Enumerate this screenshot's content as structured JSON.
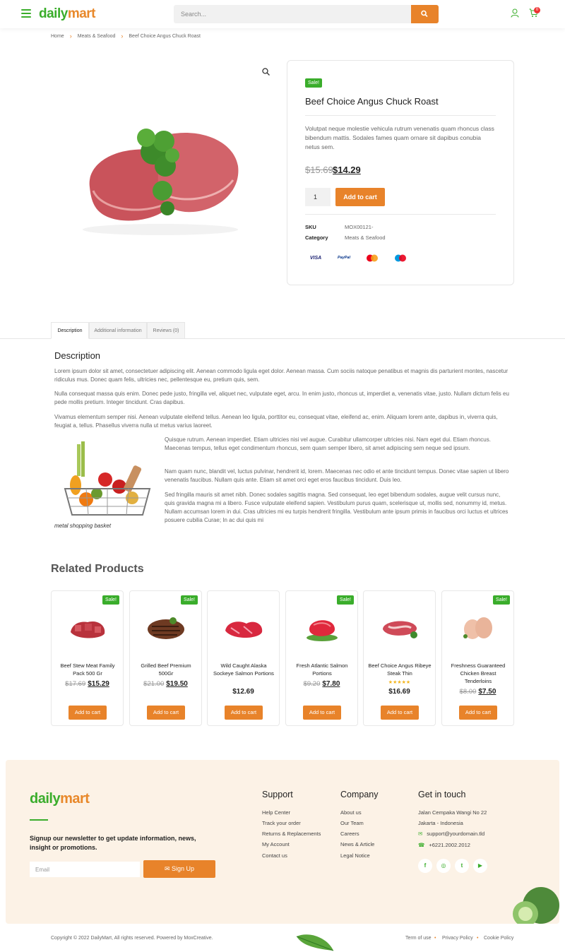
{
  "header": {
    "logo_part1": "daily",
    "logo_part2": "mart",
    "search_placeholder": "Search...",
    "cart_count": "0"
  },
  "breadcrumb": [
    "Home",
    "Meats & Seafood",
    "Beef Choice Angus Chuck Roast"
  ],
  "product": {
    "sale_label": "Sale!",
    "title": "Beef Choice Angus Chuck Roast",
    "description": "Volutpat neque molestie vehicula rutrum venenatis quam rhoncus class bibendum mattis. Sodales fames quam ornare sit dapibus conubia netus sem.",
    "old_price": "$15.69",
    "new_price": "$14.29",
    "quantity": "1",
    "add_to_cart": "Add to cart",
    "sku_label": "SKU",
    "sku_value": "MOX00121-",
    "category_label": "Category",
    "category_value": "Meats & Seafood",
    "payments": [
      "VISA",
      "PayPal",
      "Mastercard",
      "Maestro"
    ]
  },
  "tabs": [
    "Description",
    "Additional information",
    "Reviews (0)"
  ],
  "description": {
    "heading": "Description",
    "paragraphs": [
      "Lorem ipsum dolor sit amet, consectetuer adipiscing elit. Aenean commodo ligula eget dolor. Aenean massa. Cum sociis natoque penatibus et magnis dis parturient montes, nascetur ridiculus mus. Donec quam felis, ultricies nec, pellentesque eu, pretium quis, sem.",
      "Nulla consequat massa quis enim. Donec pede justo, fringilla vel, aliquet nec, vulputate eget, arcu. In enim justo, rhoncus ut, imperdiet a, venenatis vitae, justo. Nullam dictum felis eu pede mollis pretium. Integer tincidunt. Cras dapibus.",
      "Vivamus elementum semper nisi. Aenean vulputate eleifend tellus. Aenean leo ligula, porttitor eu, consequat vitae, eleifend ac, enim. Aliquam lorem ante, dapibus in, viverra quis, feugiat a, tellus. Phasellus viverra nulla ut metus varius laoreet.",
      "Quisque rutrum. Aenean imperdiet. Etiam ultricies nisi vel augue. Curabitur ullamcorper ultricies nisi. Nam eget dui. Etiam rhoncus. Maecenas tempus, tellus eget condimentum rhoncus, sem quam semper libero, sit amet adipiscing sem neque sed ipsum.",
      "Nam quam nunc, blandit vel, luctus pulvinar, hendrerit id, lorem. Maecenas nec odio et ante tincidunt tempus. Donec vitae sapien ut libero venenatis faucibus. Nullam quis ante. Etiam sit amet orci eget eros faucibus tincidunt. Duis leo.",
      "Sed fringilla mauris sit amet nibh. Donec sodales sagittis magna. Sed consequat, leo eget bibendum sodales, augue velit cursus nunc, quis gravida magna mi a libero. Fusce vulputate eleifend sapien. Vestibulum purus quam, scelerisque ut, mollis sed, nonummy id, metus. Nullam accumsan lorem in dui. Cras ultricies mi eu turpis hendrerit fringilla. Vestibulum ante ipsum primis in faucibus orci luctus et ultrices posuere cubilia Curae; In ac dui quis mi"
    ],
    "caption": "metal shopping basket"
  },
  "related": {
    "heading": "Related Products",
    "sale_label": "Sale!",
    "button": "Add to cart",
    "items": [
      {
        "name": "Beef Stew Meat Family Pack 500 Gr",
        "old": "$17.69",
        "price": "$15.29",
        "sale": true
      },
      {
        "name": "Grilled Beef Premium 500Gr",
        "old": "$21.00",
        "price": "$19.50",
        "sale": true
      },
      {
        "name": "Wild Caught Alaska Sockeye Salmon Portions",
        "old": "",
        "price": "$12.69",
        "sale": false
      },
      {
        "name": "Fresh Atlantic Salmon Portions",
        "old": "$9.20",
        "price": "$7.80",
        "sale": true
      },
      {
        "name": "Beef Choice Angus Ribeye Steak Thin",
        "old": "",
        "price": "$16.69",
        "sale": false,
        "rating": 5
      },
      {
        "name": "Freshness Guaranteed Chicken Breast Tenderloins",
        "old": "$8.00",
        "price": "$7.50",
        "sale": true
      }
    ]
  },
  "footer": {
    "newsletter_text": "Signup our newsletter to get update information, news, insight or promotions.",
    "email_placeholder": "Email",
    "signup_button": "Sign Up",
    "support_title": "Support",
    "support_links": [
      "Help Center",
      "Track your order",
      "Returns & Replacements",
      "My Account",
      "Contact us"
    ],
    "company_title": "Company",
    "company_links": [
      "About us",
      "Our Team",
      "Careers",
      "News & Article",
      "Legal Notice"
    ],
    "contact_title": "Get in touch",
    "address1": "Jalan Cempaka Wangi No 22",
    "address2": "Jakarta - Indonesia",
    "email": "support@yourdomain.tld",
    "phone": "+6221.2002.2012",
    "copyright": "Copyright © 2022 DailyMart, All rights reserved. Powered by MoxCreative.",
    "legal_links": [
      "Term of use",
      "Privacy Policy",
      "Cookie Policy"
    ]
  },
  "colors": {
    "accent": "#e8832a",
    "brand_green": "#3aad2b",
    "footer_bg": "#fcf2e6"
  }
}
